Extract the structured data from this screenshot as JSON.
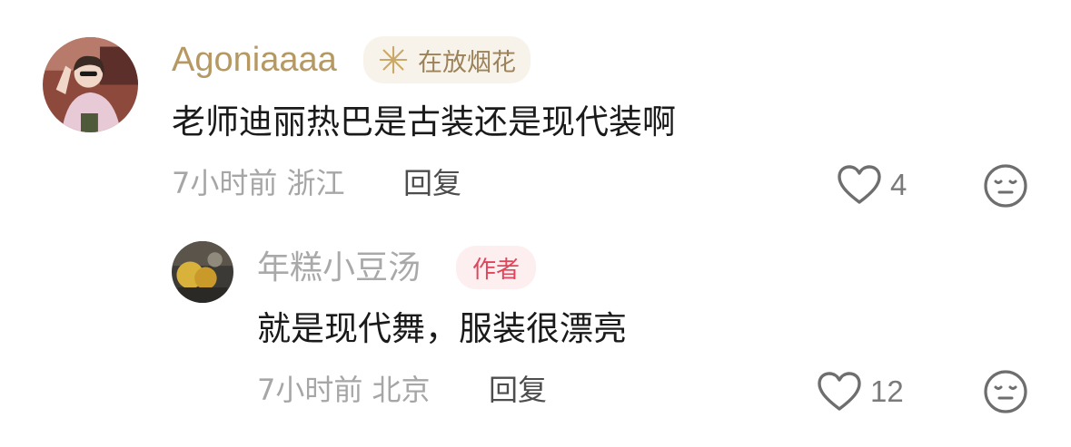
{
  "comment": {
    "username": "Agoniaaaa",
    "badge": "在放烟花",
    "text": "老师迪丽热巴是古装还是现代装啊",
    "time_location": "7小时前 浙江",
    "reply_label": "回复",
    "likes": "4",
    "avatar_icon": "user-avatar-photo",
    "reaction_icon": "neutral-face-icon"
  },
  "reply": {
    "username": "年糕小豆汤",
    "badge": "作者",
    "text": "就是现代舞，服装很漂亮",
    "time_location": "7小时前 北京",
    "reply_label": "回复",
    "likes": "12",
    "avatar_icon": "user-avatar-photo",
    "reaction_icon": "neutral-face-icon"
  },
  "colors": {
    "username_gold": "#b69863",
    "author_badge_text": "#e0455a",
    "author_badge_bg": "#fdeef0",
    "meta_gray": "#a6a6a6"
  }
}
